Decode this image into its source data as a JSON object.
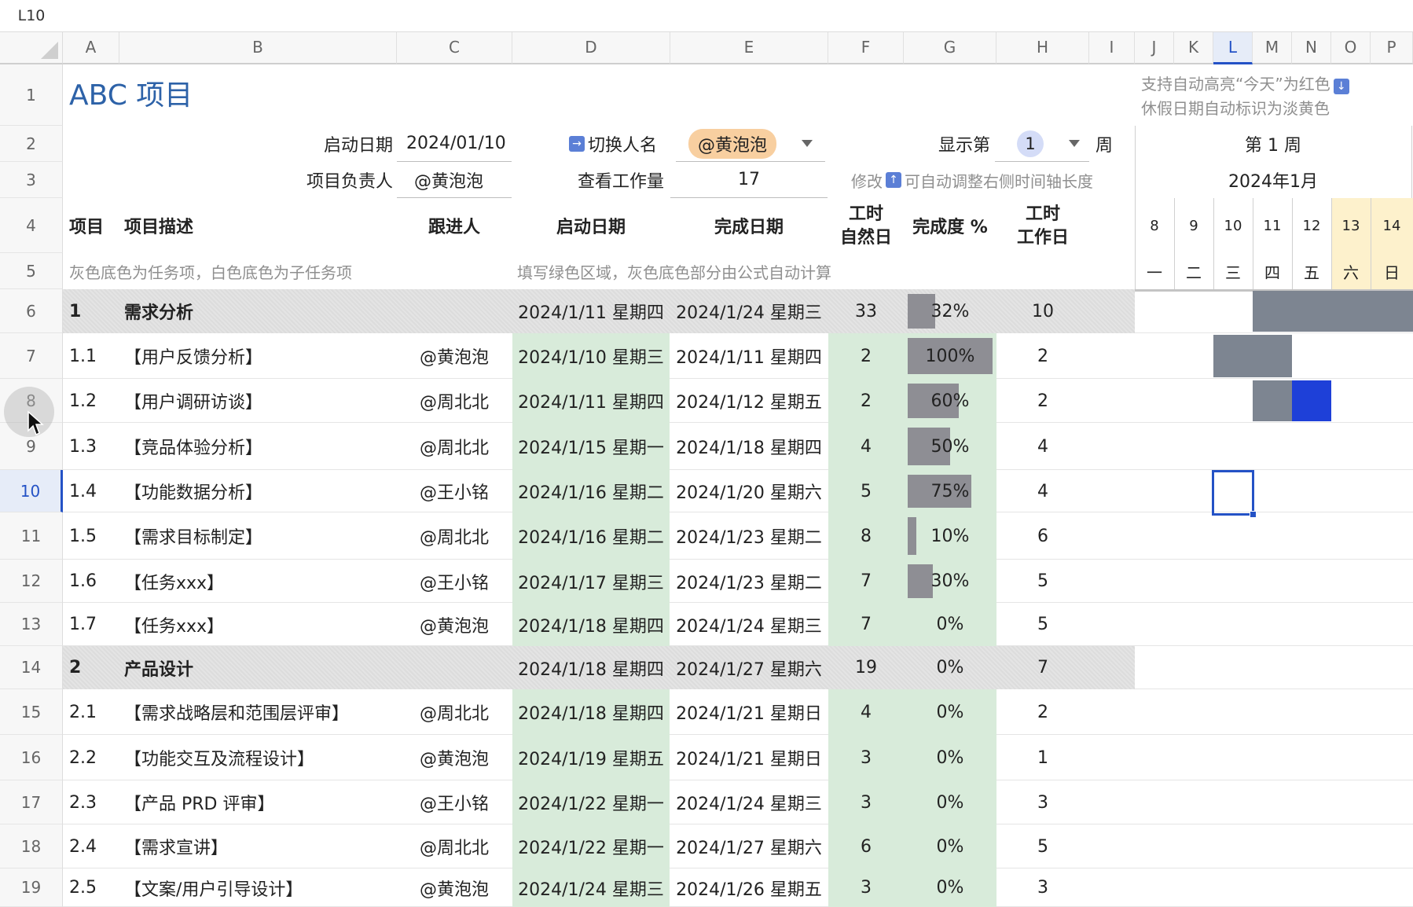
{
  "name_box": "L10",
  "columns": [
    "A",
    "B",
    "C",
    "D",
    "E",
    "F",
    "G",
    "H",
    "I",
    "J",
    "K",
    "L",
    "M",
    "N",
    "O",
    "P"
  ],
  "rows": [
    "1",
    "2",
    "3",
    "4",
    "5",
    "6",
    "7",
    "8",
    "9",
    "10",
    "11",
    "12",
    "13",
    "14",
    "15",
    "16",
    "17",
    "18",
    "19"
  ],
  "header": {
    "title": "ABC 项目",
    "note1": "支持自动高亮“今天”为红色",
    "note2": "休假日期自动标识为淡黄色",
    "start_label": "启动日期",
    "start_value": "2024/01/10",
    "switch_label": "切换人名",
    "switch_value": "@黄泡泡",
    "owner_label": "项目负责人",
    "owner_value": "@黄泡泡",
    "workload_label": "查看工作量",
    "workload_value": "17",
    "week_label_pre": "显示第",
    "week_value": "1",
    "week_label_post": "周",
    "modify_pre": "修改",
    "modify_post": "可自动调整右侧时间轴长度",
    "week_title": "第 1 周",
    "month_title": "2024年1月",
    "days": [
      "8",
      "9",
      "10",
      "11",
      "12",
      "13",
      "14"
    ],
    "weekdays": [
      "一",
      "二",
      "三",
      "四",
      "五",
      "六",
      "日"
    ]
  },
  "table_header": {
    "item": "项目",
    "desc": "项目描述",
    "person": "跟进人",
    "start": "启动日期",
    "end": "完成日期",
    "hours_cal_1": "工时",
    "hours_cal_2": "自然日",
    "progress": "完成度 %",
    "hours_work_1": "工时",
    "hours_work_2": "工作日",
    "hint_left": "灰色底色为任务项，白色底色为子任务项",
    "hint_right": "填写绿色区域，灰色底色部分由公式自动计算"
  },
  "tasks": [
    {
      "id": "1",
      "desc": "需求分析",
      "person": "",
      "start": "2024/1/11 星期四",
      "end": "2024/1/24 星期三",
      "cal": "33",
      "pct": "32%",
      "pct_value": 0.32,
      "work": "10",
      "group": true
    },
    {
      "id": "1.1",
      "desc": "【用户反馈分析】",
      "person": "@黄泡泡",
      "start": "2024/1/10 星期三",
      "end": "2024/1/11 星期四",
      "cal": "2",
      "pct": "100%",
      "pct_value": 1.0,
      "work": "2",
      "group": false
    },
    {
      "id": "1.2",
      "desc": "【用户调研访谈】",
      "person": "@周北北",
      "start": "2024/1/11 星期四",
      "end": "2024/1/12 星期五",
      "cal": "2",
      "pct": "60%",
      "pct_value": 0.6,
      "work": "2",
      "group": false
    },
    {
      "id": "1.3",
      "desc": "【竞品体验分析】",
      "person": "@周北北",
      "start": "2024/1/15 星期一",
      "end": "2024/1/18 星期四",
      "cal": "4",
      "pct": "50%",
      "pct_value": 0.5,
      "work": "4",
      "group": false
    },
    {
      "id": "1.4",
      "desc": "【功能数据分析】",
      "person": "@王小铭",
      "start": "2024/1/16 星期二",
      "end": "2024/1/20 星期六",
      "cal": "5",
      "pct": "75%",
      "pct_value": 0.75,
      "work": "4",
      "group": false
    },
    {
      "id": "1.5",
      "desc": "【需求目标制定】",
      "person": "@周北北",
      "start": "2024/1/16 星期二",
      "end": "2024/1/23 星期二",
      "cal": "8",
      "pct": "10%",
      "pct_value": 0.1,
      "work": "6",
      "group": false
    },
    {
      "id": "1.6",
      "desc": "【任务xxx】",
      "person": "@王小铭",
      "start": "2024/1/17 星期三",
      "end": "2024/1/23 星期二",
      "cal": "7",
      "pct": "30%",
      "pct_value": 0.3,
      "work": "5",
      "group": false
    },
    {
      "id": "1.7",
      "desc": "【任务xxx】",
      "person": "@黄泡泡",
      "start": "2024/1/18 星期四",
      "end": "2024/1/24 星期三",
      "cal": "7",
      "pct": "0%",
      "pct_value": 0,
      "work": "5",
      "group": false
    },
    {
      "id": "2",
      "desc": "产品设计",
      "person": "",
      "start": "2024/1/18 星期四",
      "end": "2024/1/27 星期六",
      "cal": "19",
      "pct": "0%",
      "pct_value": 0,
      "work": "7",
      "group": true
    },
    {
      "id": "2.1",
      "desc": "【需求战略层和范围层评审】",
      "person": "@周北北",
      "start": "2024/1/18 星期四",
      "end": "2024/1/21 星期日",
      "cal": "4",
      "pct": "0%",
      "pct_value": 0,
      "work": "2",
      "group": false
    },
    {
      "id": "2.2",
      "desc": "【功能交互及流程设计】",
      "person": "@黄泡泡",
      "start": "2024/1/19 星期五",
      "end": "2024/1/21 星期日",
      "cal": "3",
      "pct": "0%",
      "pct_value": 0,
      "work": "1",
      "group": false
    },
    {
      "id": "2.3",
      "desc": "【产品 PRD 评审】",
      "person": "@王小铭",
      "start": "2024/1/22 星期一",
      "end": "2024/1/24 星期三",
      "cal": "3",
      "pct": "0%",
      "pct_value": 0,
      "work": "3",
      "group": false
    },
    {
      "id": "2.4",
      "desc": "【需求宣讲】",
      "person": "@周北北",
      "start": "2024/1/22 星期一",
      "end": "2024/1/27 星期六",
      "cal": "6",
      "pct": "0%",
      "pct_value": 0,
      "work": "5",
      "group": false
    },
    {
      "id": "2.5",
      "desc": "【文案/用户引导设计】",
      "person": "@黄泡泡",
      "start": "2024/1/24 星期三",
      "end": "2024/1/26 星期五",
      "cal": "3",
      "pct": "0%",
      "pct_value": 0,
      "work": "3",
      "group": false
    }
  ],
  "colors": {
    "accent": "#2452c6",
    "green_fill": "#d8ebda",
    "progress_bar": "#8e8e94",
    "gantt_bar": "#7d8591",
    "today_bar": "#1e40d8",
    "weekend": "#fdf1cc"
  }
}
